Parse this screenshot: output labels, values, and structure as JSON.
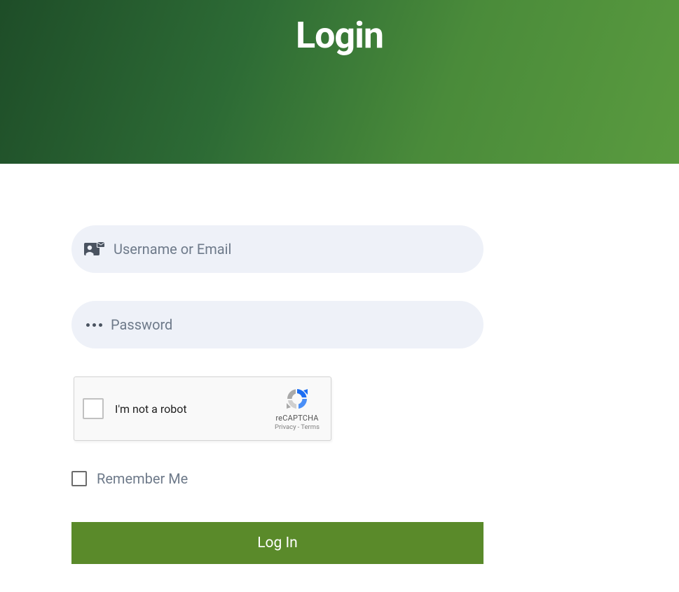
{
  "hero": {
    "title": "Login"
  },
  "form": {
    "username": {
      "placeholder": "Username or Email",
      "value": ""
    },
    "password": {
      "placeholder": "Password",
      "value": ""
    },
    "recaptcha": {
      "label": "I'm not a robot",
      "brand": "reCAPTCHA",
      "privacy": "Privacy",
      "terms": "Terms",
      "separator": "-"
    },
    "remember": {
      "label": "Remember Me",
      "checked": false
    },
    "submit": {
      "label": "Log In"
    }
  }
}
